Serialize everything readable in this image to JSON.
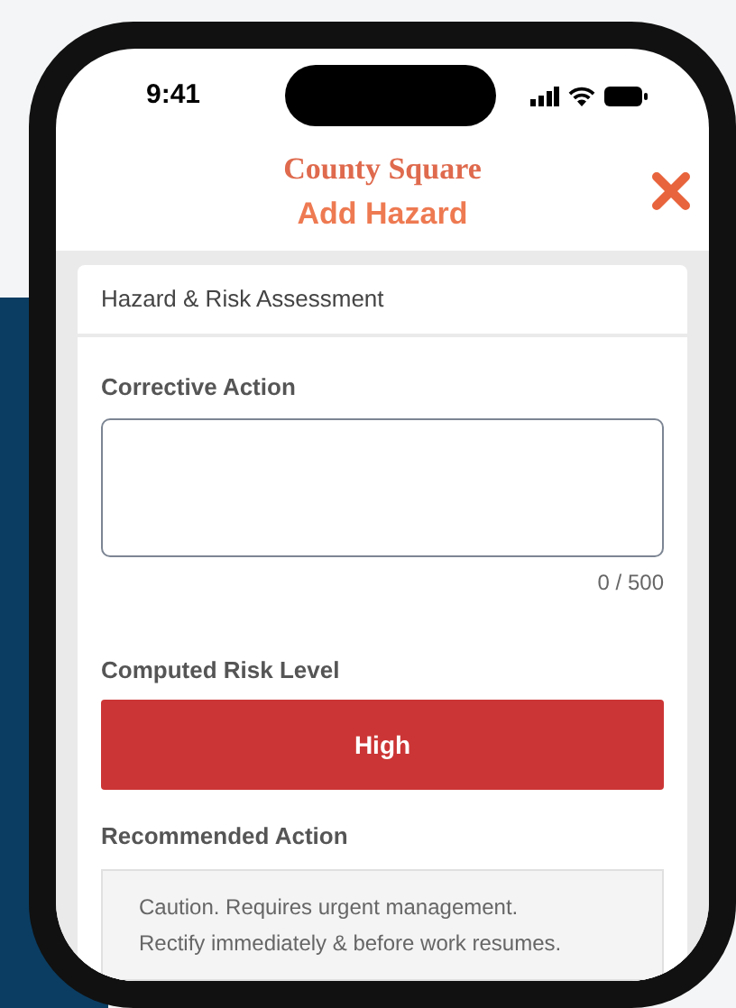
{
  "status_bar": {
    "time": "9:41"
  },
  "header": {
    "title": "County Square",
    "subtitle": "Add Hazard"
  },
  "section_title": "Hazard & Risk Assessment",
  "corrective_action": {
    "label": "Corrective Action",
    "counter": "0 / 500"
  },
  "risk": {
    "label": "Computed Risk Level",
    "value": "High",
    "kind": "high"
  },
  "recommended_action": {
    "label": "Recommended Action",
    "text": "Caution. Requires urgent management. Rectify immediately & before work resumes."
  }
}
